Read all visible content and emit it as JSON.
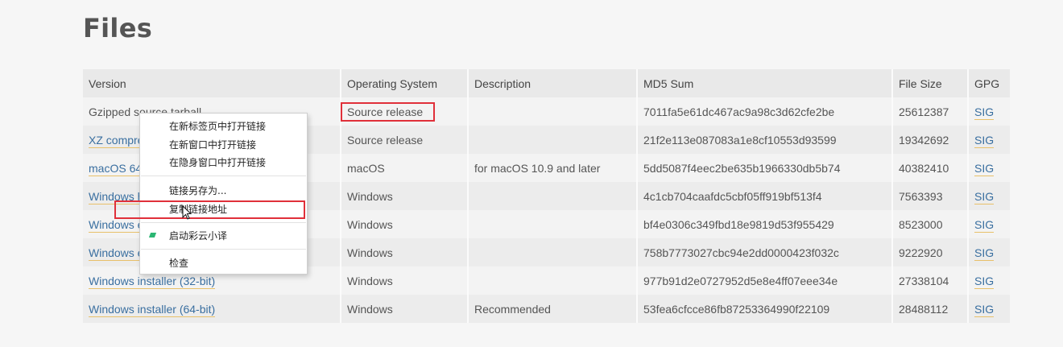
{
  "page_title": "Files",
  "table": {
    "headers": [
      "Version",
      "Operating System",
      "Description",
      "MD5 Sum",
      "File Size",
      "GPG"
    ],
    "rows": [
      {
        "version": "Gzipped source tarball",
        "os": "Source release",
        "description": "",
        "md5": "7011fa5e61dc467ac9a98c3d62cfe2be",
        "size": "25612387",
        "gpg": "SIG"
      },
      {
        "version": "XZ compressed source tarball",
        "os": "Source release",
        "description": "",
        "md5": "21f2e113e087083a1e8cf10553d93599",
        "size": "19342692",
        "gpg": "SIG"
      },
      {
        "version": "macOS 64-bit installer",
        "os": "macOS",
        "description": "for macOS 10.9 and later",
        "md5": "5dd5087f4eec2be635b1966330db5b74",
        "size": "40382410",
        "gpg": "SIG"
      },
      {
        "version": "Windows help file",
        "os": "Windows",
        "description": "",
        "md5": "4c1cb704caafdc5cbf05ff919bf513f4",
        "size": "7563393",
        "gpg": "SIG"
      },
      {
        "version": "Windows embeddable package (32-bit)",
        "os": "Windows",
        "description": "",
        "md5": "bf4e0306c349fbd18e9819d53f955429",
        "size": "8523000",
        "gpg": "SIG"
      },
      {
        "version": "Windows embeddable package (64-bit)",
        "os": "Windows",
        "description": "",
        "md5": "758b7773027cbc94e2dd0000423f032c",
        "size": "9222920",
        "gpg": "SIG"
      },
      {
        "version": "Windows installer (32-bit)",
        "os": "Windows",
        "description": "",
        "md5": "977b91d2e0727952d5e8e4ff07eee34e",
        "size": "27338104",
        "gpg": "SIG"
      },
      {
        "version": "Windows installer (64-bit)",
        "os": "Windows",
        "description": "Recommended",
        "md5": "53fea6cfcce86fb87253364990f22109",
        "size": "28488112",
        "gpg": "SIG"
      }
    ]
  },
  "context_menu": {
    "items": [
      {
        "label": "在新标签页中打开链接"
      },
      {
        "label": "在新窗口中打开链接"
      },
      {
        "label": "在隐身窗口中打开链接"
      },
      {
        "label": "链接另存为..."
      },
      {
        "label": "复制链接地址"
      },
      {
        "label": "启动彩云小译",
        "icon": "caiyun-translate-icon"
      },
      {
        "label": "检查"
      }
    ]
  },
  "colors": {
    "link": "#3a6fa0",
    "highlight": "#e0303a",
    "link_underline": "#e8c06a"
  }
}
